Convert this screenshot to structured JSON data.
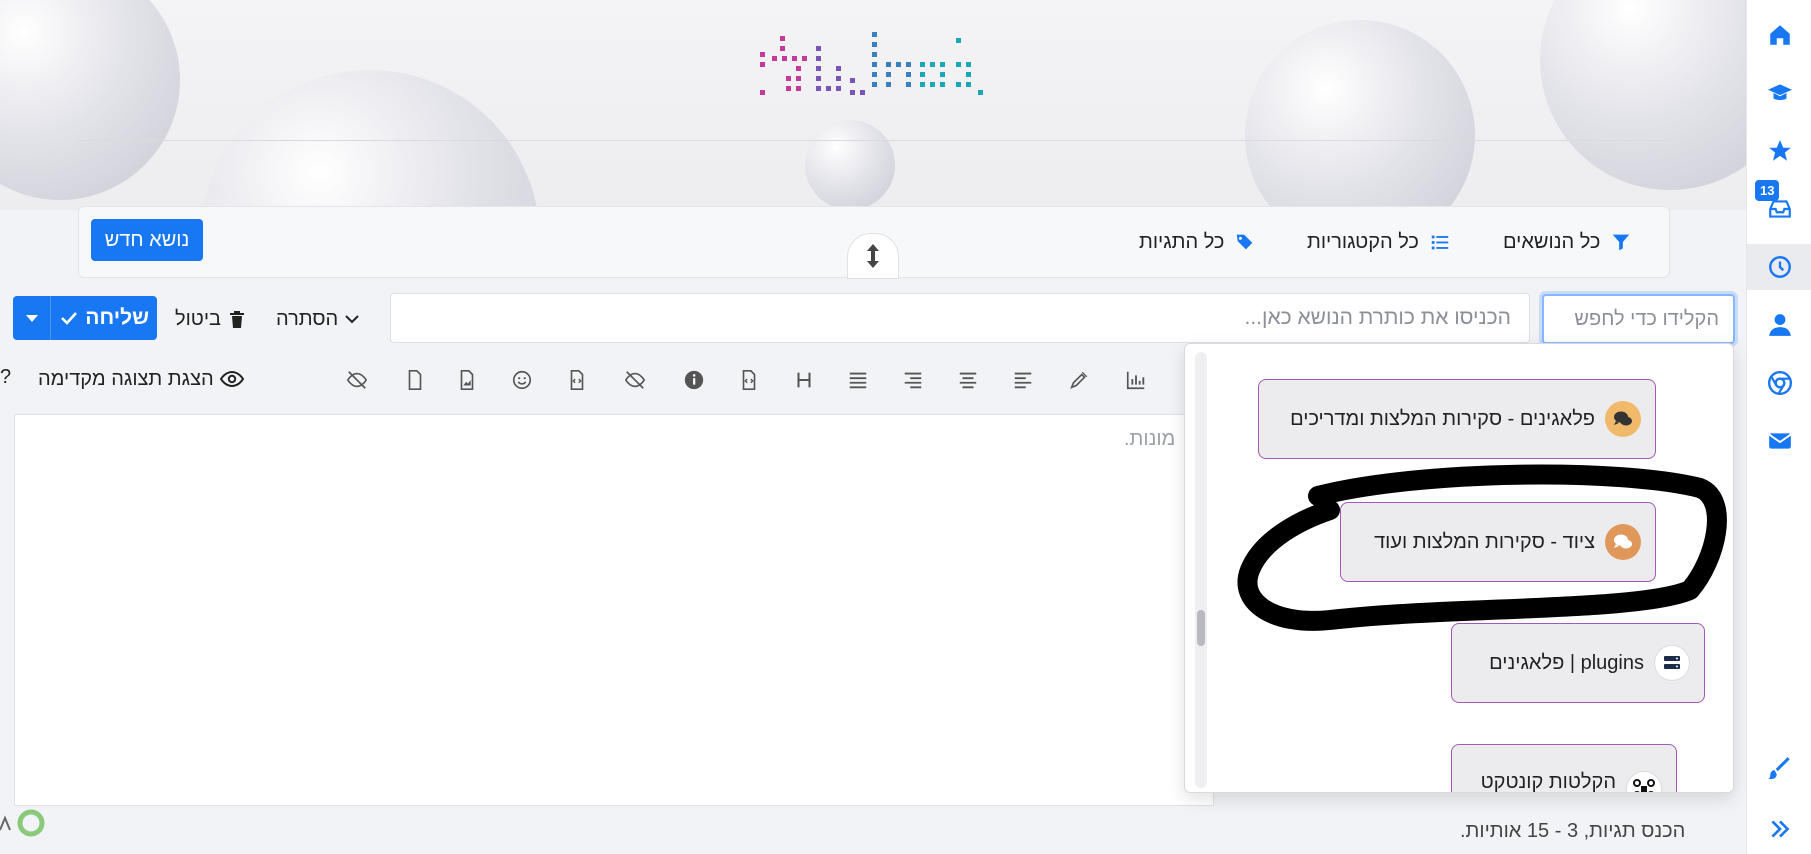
{
  "nav": {
    "new_topic": "נושא חדש",
    "all_topics": "כל הנושאים",
    "all_categories": "כל הקטגוריות",
    "all_tags": "כל התגיות"
  },
  "composer": {
    "submit": "שליחה",
    "cancel": "ביטול",
    "hide": "הסתרה",
    "title_placeholder": "הכניסו את כותרת הנושא כאן...",
    "search_placeholder": "הקלידו כדי לחפש",
    "preview_toggle": "הצגת תצוגה מקדימה",
    "editor_hint": "מונות.",
    "tags_hint": "הכנס תגיות, 3 - 15 אותיות.",
    "help": "?"
  },
  "sidebar": {
    "badge": "13",
    "icons": [
      "home-icon",
      "graduation-cap-icon",
      "star-icon",
      "inbox-icon",
      "clock-icon",
      "user-icon",
      "chrome-icon",
      "envelope-icon",
      "brush-icon",
      "chevrons-right-icon"
    ]
  },
  "dropdown": {
    "categories": [
      {
        "label": "פלאגינים - סקירות המלצות ומדריכים",
        "icon": "comments-icon",
        "icon_color": "#f1b96a"
      },
      {
        "label": "ציוד - סקירות המלצות ועוד",
        "icon": "comments-icon",
        "icon_color": "#e0975a"
      },
      {
        "label": "plugins | פלאגינים",
        "icon": "server-icon",
        "icon_color": "#ffffff"
      },
      {
        "label": "הקלטות קונטקט",
        "icon": "drone-icon",
        "icon_color": "#ffffff"
      }
    ]
  },
  "colors": {
    "accent": "#1877f2",
    "category_border": "#a05ab5"
  }
}
